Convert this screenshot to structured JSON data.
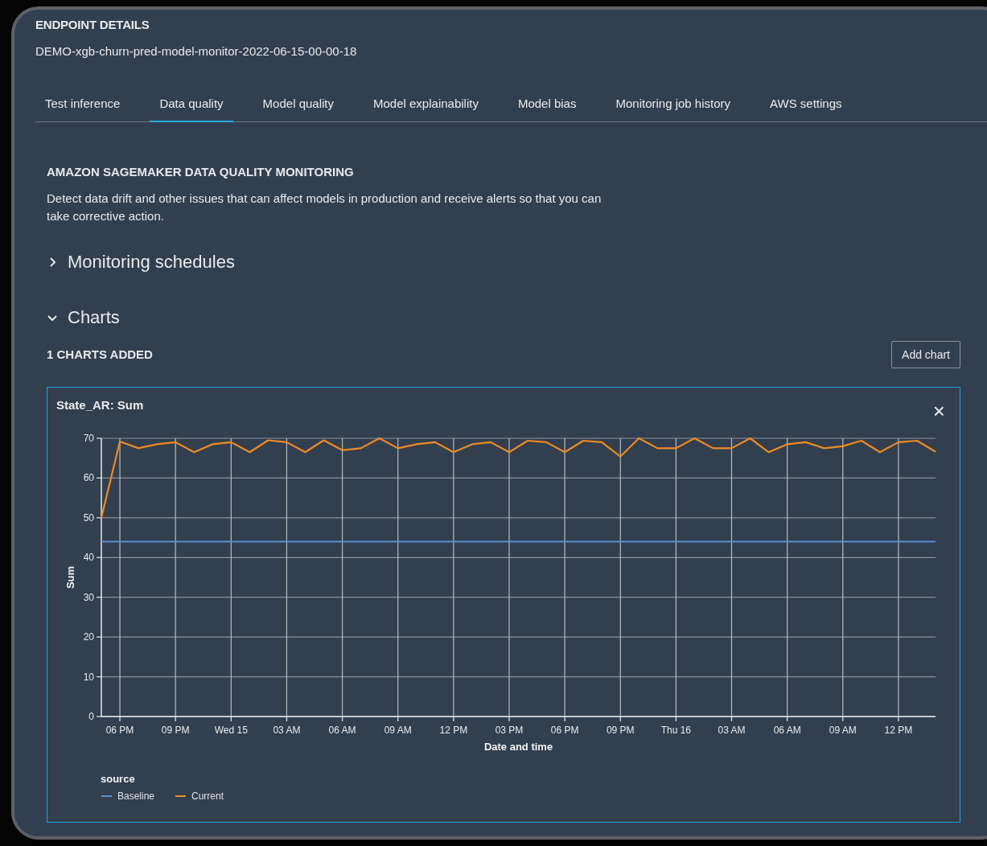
{
  "header": {
    "label": "ENDPOINT DETAILS",
    "endpoint_name": "DEMO-xgb-churn-pred-model-monitor-2022-06-15-00-00-18"
  },
  "tabs": [
    {
      "label": "Test inference",
      "selected": false
    },
    {
      "label": "Data quality",
      "selected": true
    },
    {
      "label": "Model quality",
      "selected": false
    },
    {
      "label": "Model explainability",
      "selected": false
    },
    {
      "label": "Model bias",
      "selected": false
    },
    {
      "label": "Monitoring job history",
      "selected": false
    },
    {
      "label": "AWS settings",
      "selected": false
    }
  ],
  "section": {
    "title": "AMAZON SAGEMAKER DATA QUALITY MONITORING",
    "description": "Detect data drift and other issues that can affect models in production and receive alerts so that you can take corrective action."
  },
  "collapsibles": [
    {
      "label": "Monitoring schedules",
      "expanded": false
    },
    {
      "label": "Charts",
      "expanded": true
    }
  ],
  "charts_count": "1 CHARTS ADDED",
  "add_chart_button": "Add chart",
  "chart_card": {
    "title": "State_AR: Sum",
    "close": "×",
    "chart_data": {
      "type": "line",
      "xlabel": "Date and time",
      "ylabel": "Sum",
      "categories": [
        null,
        "06 PM",
        null,
        null,
        "09 PM",
        null,
        null,
        "Wed 15",
        null,
        null,
        "03 AM",
        null,
        null,
        "06 AM",
        null,
        null,
        "09 AM",
        null,
        null,
        "12 PM",
        null,
        null,
        "03 PM",
        null,
        null,
        "06 PM",
        null,
        null,
        "09 PM",
        null,
        null,
        "Thu 16",
        null,
        null,
        "03 AM",
        null,
        null,
        "06 AM",
        null,
        null,
        "09 AM",
        null,
        null,
        "12 PM",
        null,
        null
      ],
      "series": [
        {
          "name": "Baseline",
          "color": "#5a8ed0",
          "values": [
            44,
            44,
            44,
            44,
            44,
            44,
            44,
            44,
            44,
            44,
            44,
            44,
            44,
            44,
            44,
            44,
            44,
            44,
            44,
            44,
            44,
            44,
            44,
            44,
            44,
            44,
            44,
            44,
            44,
            44,
            44,
            44,
            44,
            44,
            44,
            44,
            44,
            44,
            44,
            44,
            44,
            44,
            44,
            44,
            44,
            44
          ]
        },
        {
          "name": "Current",
          "color": "#ee8a23",
          "values": [
            50,
            69.2,
            67.5,
            68.5,
            69,
            66.5,
            68.5,
            69,
            66.5,
            69.5,
            69,
            66.5,
            69.5,
            67,
            67.5,
            70,
            67.5,
            68.5,
            69,
            66.5,
            68.5,
            69,
            66.5,
            69.4,
            69,
            66.5,
            69.4,
            69,
            65.4,
            70,
            67.5,
            67.5,
            70,
            67.5,
            67.5,
            70,
            66.5,
            68.5,
            69,
            67.5,
            68,
            69.4,
            66.5,
            69,
            69.4,
            66.6
          ]
        }
      ],
      "ylim": [
        0,
        70
      ],
      "yticks": [
        0,
        10,
        20,
        30,
        40,
        50,
        60,
        70
      ],
      "grid": true,
      "legend": {
        "title": "source"
      }
    }
  }
}
